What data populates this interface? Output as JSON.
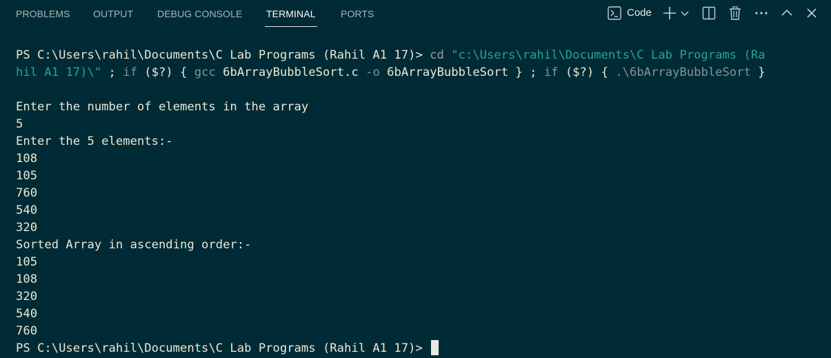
{
  "tabs": [
    {
      "label": "PROBLEMS"
    },
    {
      "label": "OUTPUT"
    },
    {
      "label": "DEBUG CONSOLE"
    },
    {
      "label": "TERMINAL"
    },
    {
      "label": "PORTS"
    }
  ],
  "active_tab": "TERMINAL",
  "toolbar": {
    "profile_label": "Code",
    "icons": [
      "terminal-icon",
      "plus-icon",
      "chevron-down-icon",
      "split-icon",
      "trash-icon",
      "more-icon",
      "chevron-up-icon",
      "close-icon"
    ]
  },
  "terminal": {
    "cmd1_prompt": "PS C:\\Users\\rahil\\Documents\\C Lab Programs (Rahil A1 17)>",
    "cmd1_cd": " cd ",
    "cmd1_path_a": "\"c:\\Users\\rahil\\Documents\\C Lab Programs (Ra",
    "cmd1_path_b": "hil A1 17)\\\"",
    "cmd1_sep1": " ; ",
    "cmd1_if1": "if",
    "cmd1_cond1": " ($?) { ",
    "cmd1_gcc": "gcc",
    "cmd1_src": " 6bArrayBubbleSort.c ",
    "cmd1_flag": "-o",
    "cmd1_out": " 6bArrayBubbleSort ",
    "cmd1_close1": "}",
    "cmd1_sep2": " ; ",
    "cmd1_if2": "if",
    "cmd1_cond2": " ($?) { ",
    "cmd1_exe": ".\\6bArrayBubbleSort",
    "cmd1_close2": " }",
    "output_lines": [
      "Enter the number of elements in the array",
      "5",
      "Enter the 5 elements:-",
      "108",
      "105",
      "760",
      "540",
      "320",
      "Sorted Array in ascending order:-",
      "105",
      "108",
      "320",
      "540",
      "760"
    ],
    "final_prompt": "PS C:\\Users\\rahil\\Documents\\C Lab Programs (Rahil A1 17)> "
  }
}
